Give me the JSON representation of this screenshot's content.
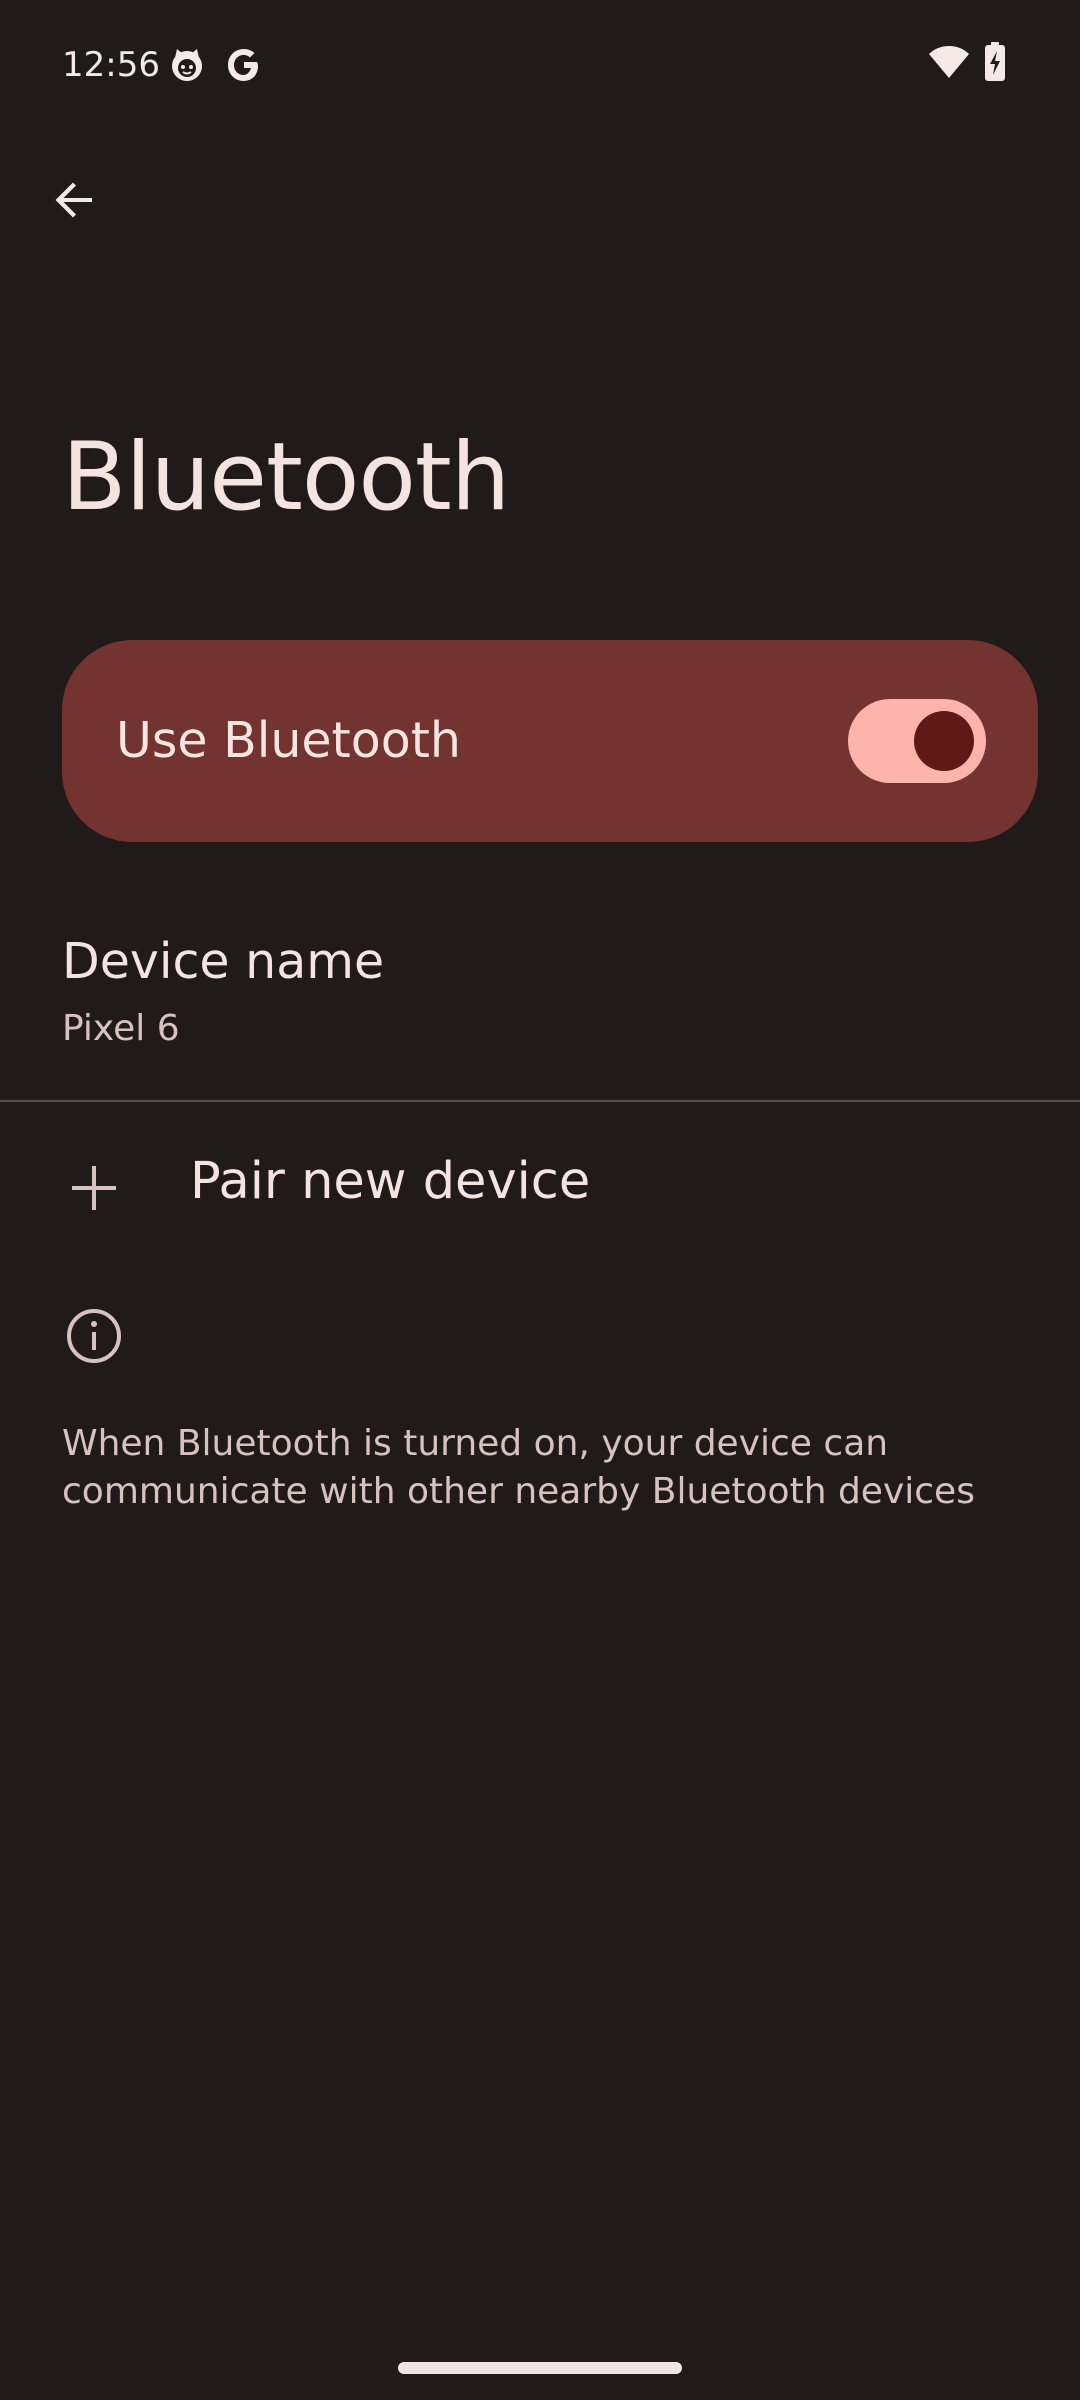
{
  "status_bar": {
    "time": "12:56",
    "left_icons": [
      "cat-face-icon",
      "google-g-icon"
    ],
    "right_icons": [
      "wifi-icon",
      "battery-charging-icon"
    ]
  },
  "top_app_bar": {
    "back_icon": "arrow-back-icon"
  },
  "page": {
    "title": "Bluetooth"
  },
  "main_switch": {
    "label": "Use Bluetooth",
    "checked": true
  },
  "device_name": {
    "title": "Device name",
    "summary": "Pixel 6"
  },
  "pair_new_device": {
    "icon": "plus-icon",
    "label": "Pair new device"
  },
  "footer": {
    "icon": "info-icon",
    "text": "When Bluetooth is turned on, your device can communicate with other nearby Bluetooth devices"
  },
  "colors": {
    "background": "#201a1a",
    "switch_bar": "#733330",
    "toggle_track": "#ffb4ab",
    "toggle_thumb": "#5f1a18",
    "primary_text": "#f5e3e1",
    "secondary_text": "#d8c2bf"
  }
}
